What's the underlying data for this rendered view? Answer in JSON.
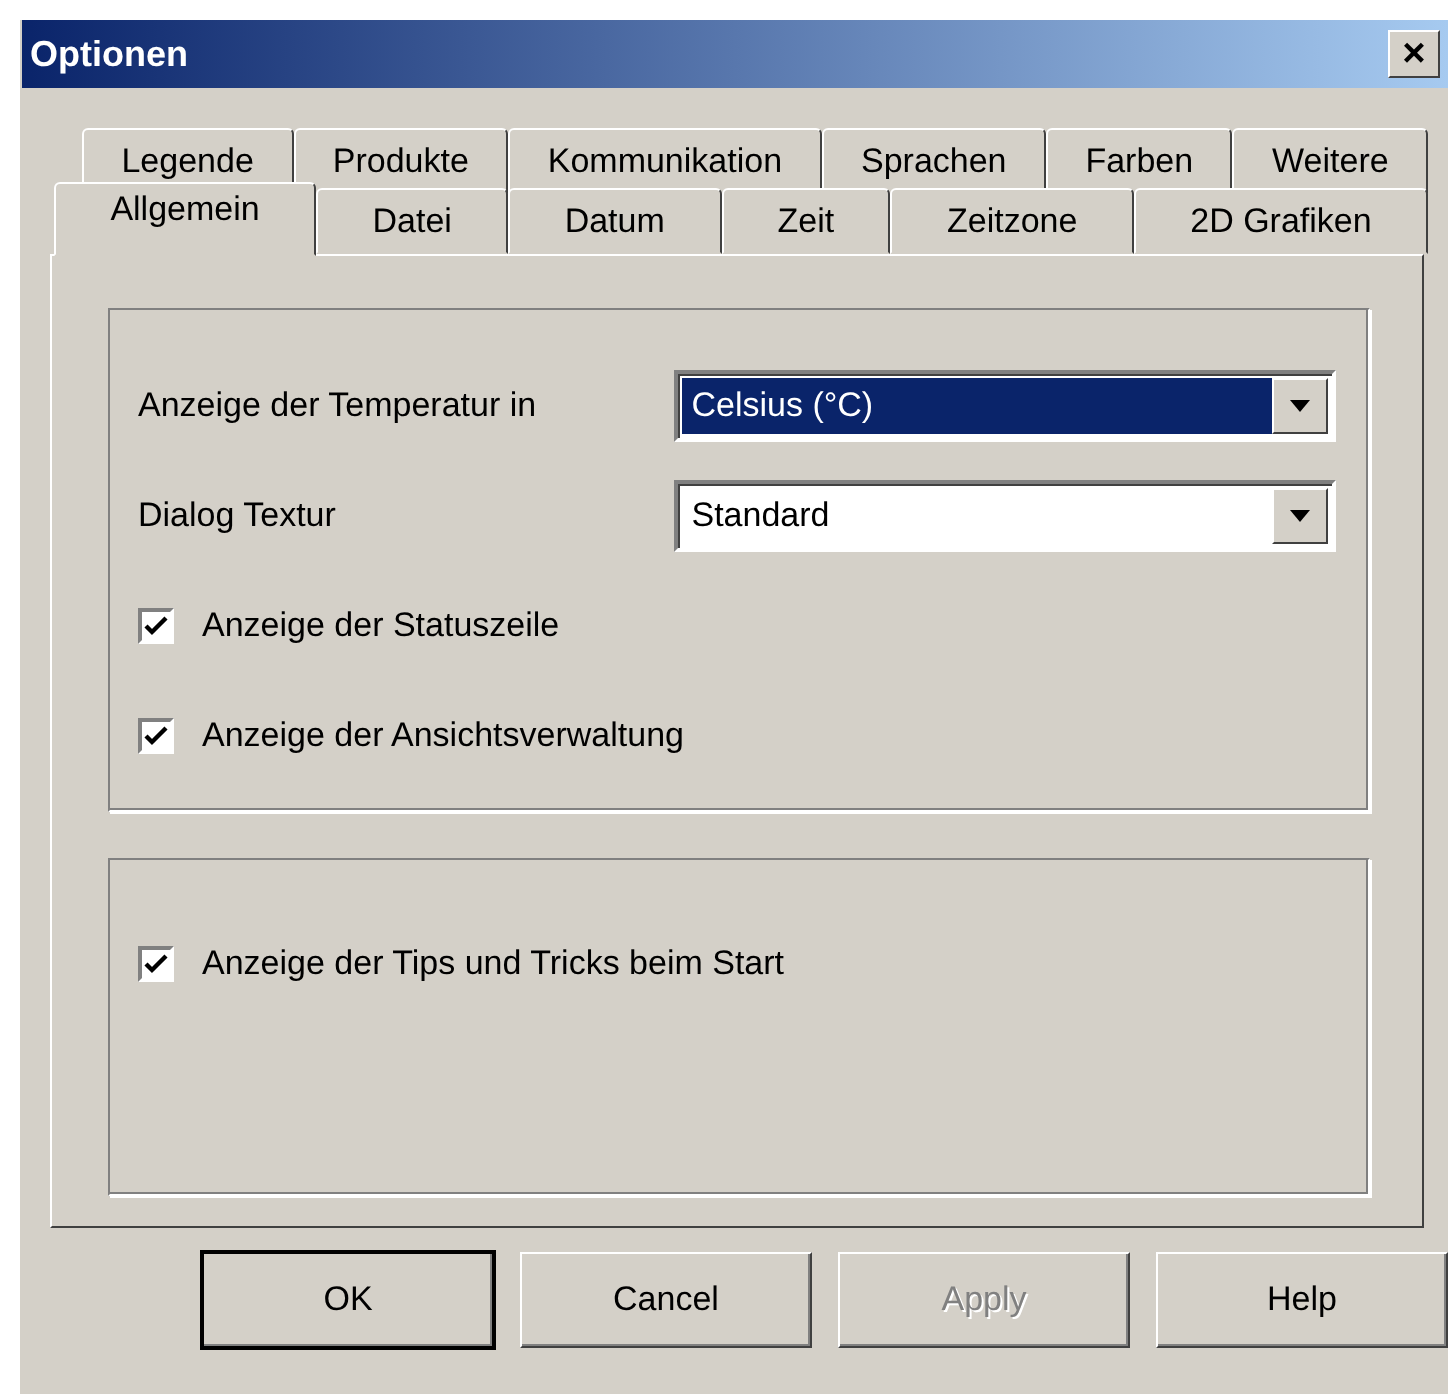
{
  "window": {
    "title": "Optionen",
    "close": "×"
  },
  "tab_rows": [
    [
      {
        "label": "Legende",
        "selected": false
      },
      {
        "label": "Produkte",
        "selected": false
      },
      {
        "label": "Kommunikation",
        "selected": false
      },
      {
        "label": "Sprachen",
        "selected": false
      },
      {
        "label": "Farben",
        "selected": false
      },
      {
        "label": "Weitere",
        "selected": false
      }
    ],
    [
      {
        "label": "Allgemein",
        "selected": true
      },
      {
        "label": "Datei",
        "selected": false
      },
      {
        "label": "Datum",
        "selected": false
      },
      {
        "label": "Zeit",
        "selected": false
      },
      {
        "label": "Zeitzone",
        "selected": false
      },
      {
        "label": "2D Grafiken",
        "selected": false
      }
    ]
  ],
  "settings": [
    {
      "kind": "combo",
      "label": "Anzeige der Temperatur in",
      "value": "Celsius (°C)",
      "focused": true
    },
    {
      "kind": "combo",
      "label": "Dialog Textur",
      "value": "Standard",
      "focused": false
    },
    {
      "kind": "checkbox",
      "label": "Anzeige der Statuszeile",
      "checked": true
    },
    {
      "kind": "checkbox",
      "label": "Anzeige der Ansichtsverwaltung",
      "checked": true
    }
  ],
  "startup": [
    {
      "kind": "checkbox",
      "label": "Anzeige der Tips und Tricks beim Start",
      "checked": true
    }
  ],
  "buttons": [
    {
      "label": "OK",
      "default": true,
      "disabled": false
    },
    {
      "label": "Cancel",
      "default": false,
      "disabled": false
    },
    {
      "label": "Apply",
      "default": false,
      "disabled": true
    },
    {
      "label": "Help",
      "default": false,
      "disabled": false
    }
  ]
}
